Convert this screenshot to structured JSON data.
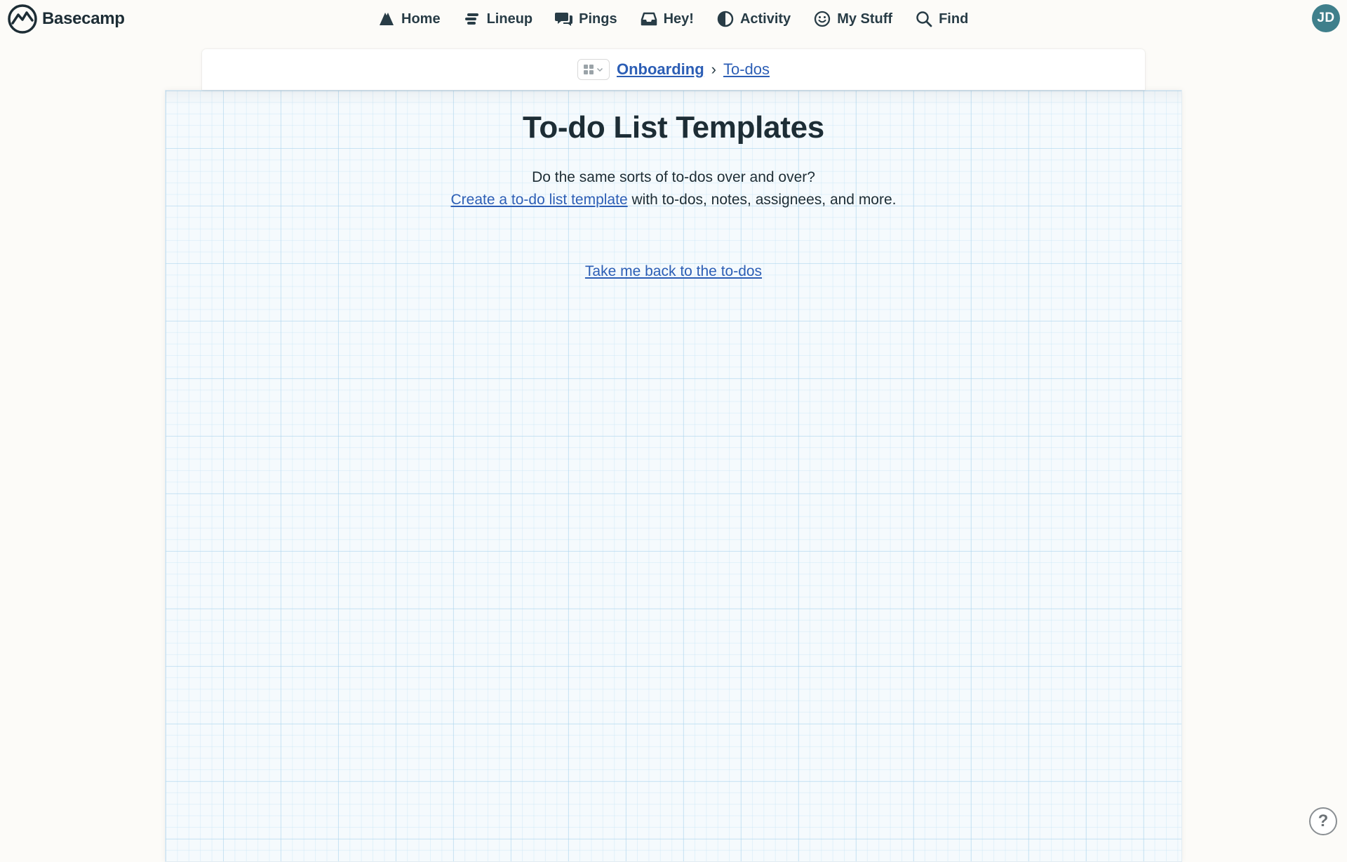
{
  "app": {
    "name": "Basecamp",
    "user_initials": "JD",
    "accent": "#2c5eb5",
    "avatar_color": "#3f7f8b"
  },
  "nav": [
    {
      "label": "Home",
      "icon": "home-icon"
    },
    {
      "label": "Lineup",
      "icon": "lineup-icon"
    },
    {
      "label": "Pings",
      "icon": "pings-icon"
    },
    {
      "label": "Hey!",
      "icon": "inbox-icon"
    },
    {
      "label": "Activity",
      "icon": "activity-icon"
    },
    {
      "label": "My Stuff",
      "icon": "smiley-icon"
    },
    {
      "label": "Find",
      "icon": "search-icon"
    }
  ],
  "breadcrumb": {
    "project": "Onboarding",
    "separator": "›",
    "tool": "To-dos"
  },
  "page": {
    "title": "To-do List Templates",
    "line1": "Do the same sorts of to-dos over and over?",
    "create_link": "Create a to-do list template",
    "line2_rest": " with to-dos, notes, assignees, and more.",
    "back_link": "Take me back to the to-dos"
  },
  "help": {
    "label": "?"
  }
}
